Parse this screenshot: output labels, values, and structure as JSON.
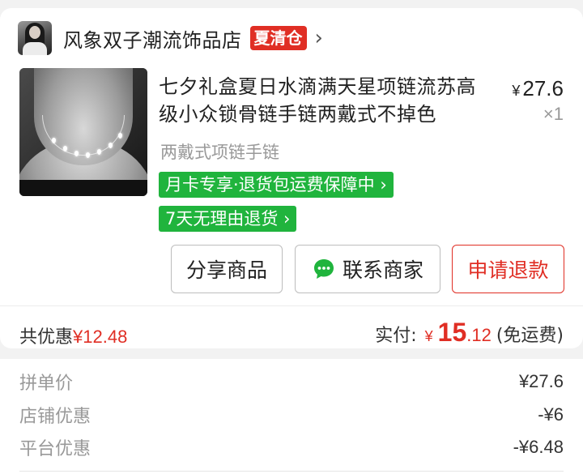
{
  "store": {
    "name": "风象双子潮流饰品店",
    "badge": "夏清仓",
    "chevron": "›"
  },
  "product": {
    "title": "七夕礼盒夏日水滴满天星项链流苏高级小众锁骨链手链两戴式不掉色",
    "price_symbol": "¥",
    "price": "27.6",
    "quantity": "×1",
    "variant": "两戴式项链手链",
    "tags": [
      "月卡专享·退货包运费保障中 ›",
      "7天无理由退货 ›"
    ]
  },
  "actions": {
    "share": "分享商品",
    "contact": "联系商家",
    "refund": "申请退款"
  },
  "summary": {
    "discount_label": "共优惠",
    "discount_value": "¥12.48",
    "paid_label": "实付:",
    "paid_symbol": "¥",
    "paid_int": "15",
    "paid_dec": ".12",
    "shipping_note": "(免运费)"
  },
  "details": [
    {
      "label": "拼单价",
      "value": "¥27.6"
    },
    {
      "label": "店铺优惠",
      "value": "-¥6"
    },
    {
      "label": "平台优惠",
      "value": "-¥6.48"
    }
  ],
  "colors": {
    "accent_red": "#e02e24",
    "tag_green": "#20b43d"
  }
}
